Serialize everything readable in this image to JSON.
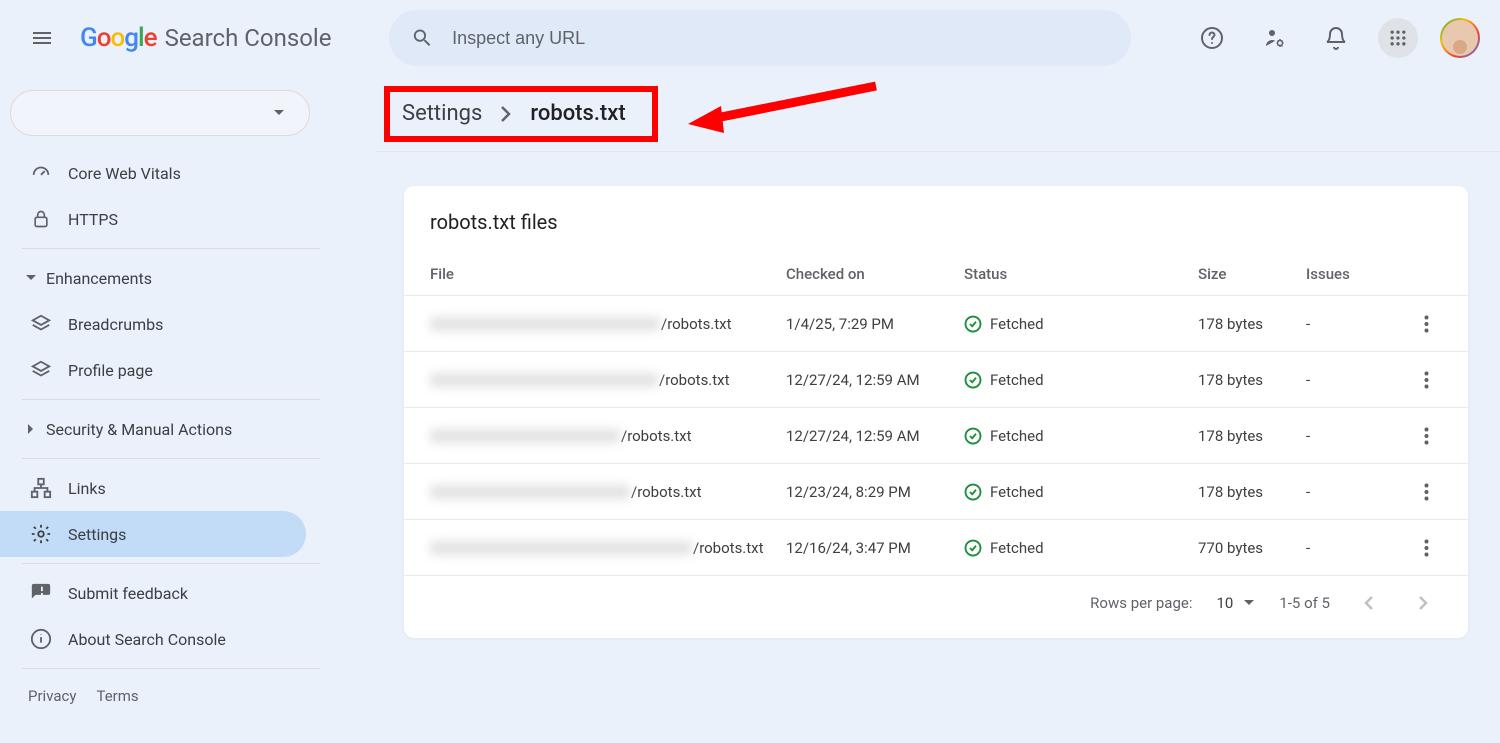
{
  "header": {
    "product_name": "Search Console",
    "search_placeholder": "Inspect any URL"
  },
  "sidebar": {
    "items": [
      {
        "label": "Core Web Vitals"
      },
      {
        "label": "HTTPS"
      }
    ],
    "enhancements_label": "Enhancements",
    "enhancements": [
      {
        "label": "Breadcrumbs"
      },
      {
        "label": "Profile page"
      }
    ],
    "security_label": "Security & Manual Actions",
    "links_label": "Links",
    "settings_label": "Settings",
    "feedback_label": "Submit feedback",
    "about_label": "About Search Console",
    "privacy_label": "Privacy",
    "terms_label": "Terms"
  },
  "breadcrumb": {
    "parent": "Settings",
    "current": "robots.txt"
  },
  "card": {
    "title": "robots.txt files",
    "columns": {
      "file": "File",
      "checked": "Checked on",
      "status": "Status",
      "size": "Size",
      "issues": "Issues"
    },
    "rows": [
      {
        "file_suffix": "/robots.txt",
        "blur_width": 230,
        "checked": "1/4/25, 7:29 PM",
        "status": "Fetched",
        "size": "178 bytes",
        "issues": "-"
      },
      {
        "file_suffix": "/robots.txt",
        "blur_width": 228,
        "checked": "12/27/24, 12:59 AM",
        "status": "Fetched",
        "size": "178 bytes",
        "issues": "-"
      },
      {
        "file_suffix": "/robots.txt",
        "blur_width": 190,
        "checked": "12/27/24, 12:59 AM",
        "status": "Fetched",
        "size": "178 bytes",
        "issues": "-"
      },
      {
        "file_suffix": "/robots.txt",
        "blur_width": 200,
        "checked": "12/23/24, 8:29 PM",
        "status": "Fetched",
        "size": "178 bytes",
        "issues": "-"
      },
      {
        "file_suffix": "/robots.txt",
        "blur_width": 262,
        "checked": "12/16/24, 3:47 PM",
        "status": "Fetched",
        "size": "770 bytes",
        "issues": "-"
      }
    ],
    "pager": {
      "rows_label": "Rows per page:",
      "rows_value": "10",
      "range": "1-5 of 5"
    }
  }
}
